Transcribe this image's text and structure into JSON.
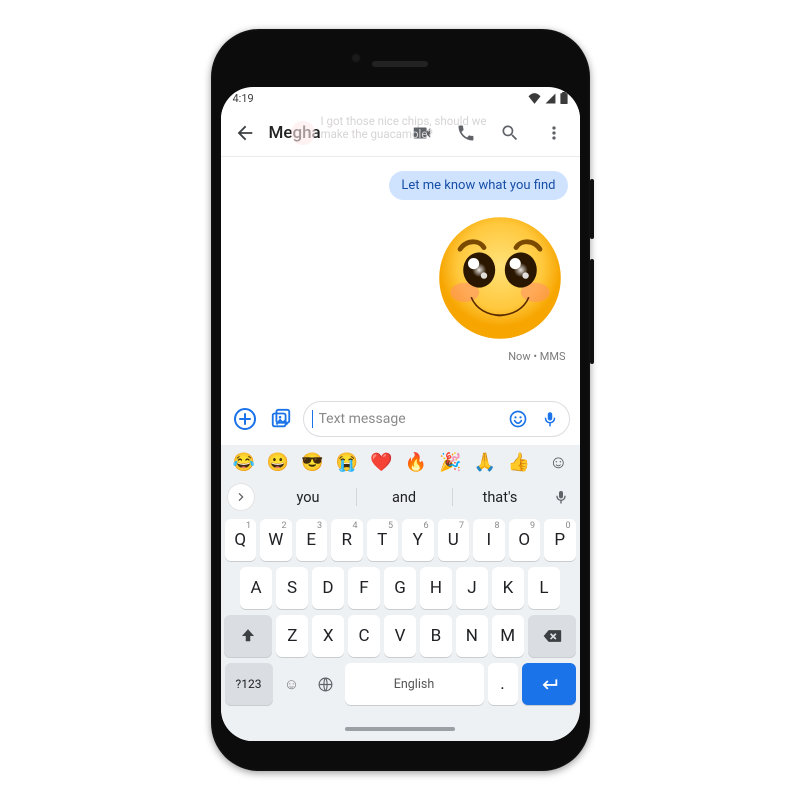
{
  "status": {
    "time": "4:19"
  },
  "appbar": {
    "contact_name": "Megha",
    "ghost_preview": "I got those nice chips, should we make the guacamole?"
  },
  "conversation": {
    "outgoing_text": "Let me know what you find",
    "sticker_desc": "pleading-happy-face-emoji",
    "timestamp": "Now • MMS"
  },
  "composer": {
    "placeholder": "Text message"
  },
  "emoji_strip": [
    "😂",
    "😀",
    "😎",
    "😭",
    "❤️",
    "🔥",
    "🎉",
    "🙏",
    "👍"
  ],
  "suggestions": {
    "w1": "you",
    "w2": "and",
    "w3": "that's"
  },
  "keyboard": {
    "row1": [
      {
        "k": "Q",
        "h": "1"
      },
      {
        "k": "W",
        "h": "2"
      },
      {
        "k": "E",
        "h": "3"
      },
      {
        "k": "R",
        "h": "4"
      },
      {
        "k": "T",
        "h": "5"
      },
      {
        "k": "Y",
        "h": "6"
      },
      {
        "k": "U",
        "h": "7"
      },
      {
        "k": "I",
        "h": "8"
      },
      {
        "k": "O",
        "h": "9"
      },
      {
        "k": "P",
        "h": "0"
      }
    ],
    "row2": [
      "A",
      "S",
      "D",
      "F",
      "G",
      "H",
      "J",
      "K",
      "L"
    ],
    "row3": [
      "Z",
      "X",
      "C",
      "V",
      "B",
      "N",
      "M"
    ],
    "symbols_label": "?123",
    "space_label": "English",
    "period": ".",
    "comma": ","
  }
}
